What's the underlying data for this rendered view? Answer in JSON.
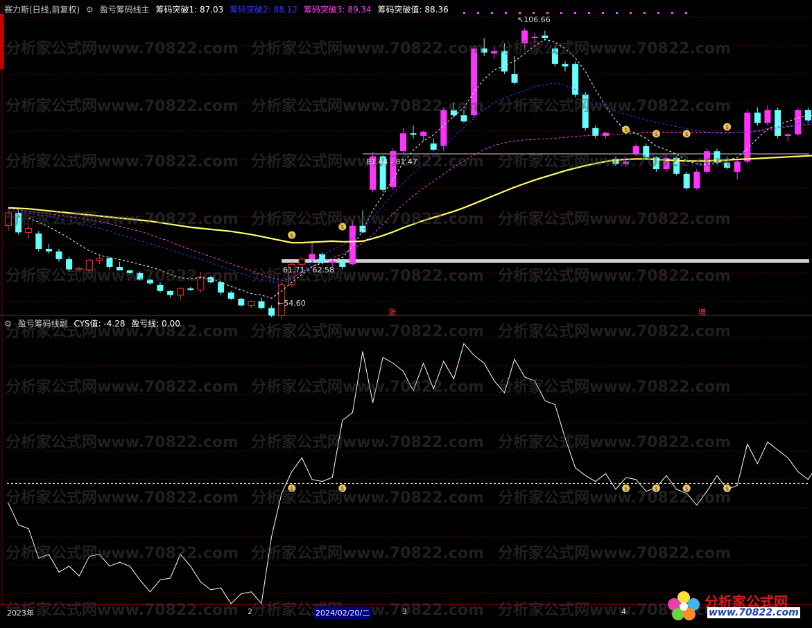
{
  "main_panel": {
    "stock": "赛力斯(日线,前复权)",
    "indicator": "盈亏筹码线主",
    "values": [
      {
        "label": "筹码突破1: 87.03",
        "color": "#ffffff"
      },
      {
        "label": "筹码突破2: 88.12",
        "color": "#2a3cff"
      },
      {
        "label": "筹码突破3: 89.34",
        "color": "#ff44ff"
      },
      {
        "label": "筹码突破值: 88.36",
        "color": "#ffffff"
      }
    ],
    "annotations": {
      "high": "106.66",
      "range_upper": "81.44 - 81.47",
      "range_lower": "61.71 - 62.58",
      "low": "54.60",
      "mark_zhang": "涨",
      "mark_zeng": "增"
    }
  },
  "sub_panel": {
    "indicator": "盈亏筹码线副",
    "values": [
      {
        "label": "CYS值: -4.28",
        "color": "#ffffff"
      },
      {
        "label": "盈亏线: 0.00",
        "color": "#ffffff"
      }
    ]
  },
  "x_axis": {
    "labels": [
      "2023年",
      "2",
      "2024/02/20/二",
      "3",
      "4"
    ]
  },
  "watermark": "分析家公式网www.70822.com",
  "logo": {
    "title": "分析家公式网",
    "url": "www.70822.com"
  },
  "chart_data": [
    {
      "type": "candlestick",
      "title": "盈亏筹码线主",
      "up_color": "#ff33ff",
      "down_color": "#66ffff",
      "ylim": [
        52,
        110
      ],
      "candles": [
        [
          68.5,
          71.5,
          67.5,
          71.0
        ],
        [
          71.0,
          71.5,
          66.8,
          67.2
        ],
        [
          67.2,
          68.5,
          66.0,
          68.0
        ],
        [
          67.0,
          67.5,
          63.5,
          64.0
        ],
        [
          64.0,
          65.0,
          63.0,
          63.5
        ],
        [
          63.5,
          64.0,
          61.5,
          62.0
        ],
        [
          62.0,
          62.5,
          59.5,
          60.0
        ],
        [
          60.0,
          60.5,
          59.8,
          60.2
        ],
        [
          59.8,
          62.0,
          59.5,
          61.8
        ],
        [
          61.8,
          62.5,
          61.0,
          62.2
        ],
        [
          62.2,
          62.5,
          60.0,
          60.5
        ],
        [
          60.5,
          61.5,
          60.0,
          59.8
        ],
        [
          59.8,
          60.0,
          59.0,
          59.3
        ],
        [
          59.3,
          59.6,
          57.8,
          58.0
        ],
        [
          58.0,
          58.2,
          57.0,
          57.3
        ],
        [
          57.0,
          57.5,
          55.5,
          55.8
        ],
        [
          55.8,
          56.0,
          54.5,
          55.0
        ],
        [
          55.0,
          56.5,
          54.0,
          56.3
        ],
        [
          56.3,
          56.6,
          55.8,
          56.0
        ],
        [
          56.0,
          59.5,
          55.5,
          58.5
        ],
        [
          58.5,
          58.8,
          57.3,
          57.5
        ],
        [
          57.5,
          57.8,
          55.0,
          55.5
        ],
        [
          55.5,
          55.8,
          54.0,
          54.3
        ],
        [
          54.3,
          54.5,
          52.8,
          53.0
        ],
        [
          53.0,
          54.0,
          52.5,
          53.8
        ],
        [
          53.8,
          54.5,
          52.2,
          52.5
        ],
        [
          52.5,
          53.0,
          50.7,
          51.0
        ],
        [
          51.0,
          57.5,
          50.4,
          57.0
        ],
        [
          57.0,
          61.5,
          56.5,
          61.0
        ],
        [
          61.0,
          62.5,
          60.0,
          62.0
        ],
        [
          62.0,
          65.5,
          61.5,
          63.0
        ],
        [
          63.0,
          63.3,
          61.0,
          61.3
        ],
        [
          61.3,
          62.0,
          60.5,
          61.7
        ],
        [
          61.7,
          62.0,
          60.0,
          60.5
        ],
        [
          61.0,
          69.5,
          60.8,
          68.5
        ],
        [
          68.5,
          71.5,
          67.0,
          67.2
        ],
        [
          75.5,
          82.8,
          75.0,
          82.0
        ],
        [
          82.0,
          82.2,
          75.0,
          75.5
        ],
        [
          76.0,
          83.5,
          75.5,
          83.0
        ],
        [
          83.0,
          87.5,
          82.5,
          86.5
        ],
        [
          86.5,
          88.0,
          85.5,
          86.2
        ],
        [
          86.0,
          87.0,
          85.0,
          86.8
        ],
        [
          84.5,
          85.5,
          83.0,
          83.3
        ],
        [
          84.0,
          91.5,
          83.0,
          91.0
        ],
        [
          91.0,
          92.5,
          89.5,
          90.0
        ],
        [
          90.0,
          91.0,
          88.5,
          88.8
        ],
        [
          90.0,
          103.5,
          89.5,
          103.0
        ],
        [
          103.0,
          105.0,
          101.5,
          102.2
        ],
        [
          102.0,
          103.5,
          101.0,
          102.5
        ],
        [
          102.5,
          104.0,
          98.0,
          98.5
        ],
        [
          98.0,
          101.5,
          96.0,
          96.3
        ],
        [
          104.0,
          107.0,
          103.0,
          106.5
        ],
        [
          105.0,
          106.0,
          104.0,
          105.3
        ],
        [
          105.5,
          106.5,
          104.5,
          105.0
        ],
        [
          103.0,
          103.5,
          99.5,
          100.0
        ],
        [
          100.0,
          100.5,
          98.5,
          99.5
        ],
        [
          100.0,
          100.5,
          93.5,
          94.0
        ],
        [
          94.0,
          94.5,
          87.0,
          87.5
        ],
        [
          87.5,
          88.0,
          85.5,
          86.0
        ],
        [
          86.0,
          86.8,
          85.5,
          86.6
        ],
        [
          81.5,
          82.0,
          80.2,
          80.5
        ],
        [
          80.5,
          82.0,
          80.0,
          81.0
        ],
        [
          82.5,
          84.5,
          82.0,
          84.0
        ],
        [
          84.0,
          84.5,
          81.5,
          81.8
        ],
        [
          81.8,
          82.0,
          79.0,
          79.5
        ],
        [
          79.5,
          82.5,
          79.0,
          81.7
        ],
        [
          81.7,
          82.0,
          78.3,
          78.6
        ],
        [
          78.6,
          79.0,
          75.5,
          75.8
        ],
        [
          75.8,
          79.5,
          75.5,
          79.0
        ],
        [
          79.0,
          83.5,
          78.5,
          83.0
        ],
        [
          83.0,
          83.5,
          80.5,
          80.8
        ],
        [
          80.8,
          82.0,
          79.5,
          79.8
        ],
        [
          79.0,
          81.5,
          77.5,
          81.0
        ],
        [
          81.0,
          91.0,
          80.5,
          90.5
        ],
        [
          90.5,
          91.5,
          88.0,
          88.5
        ],
        [
          88.5,
          92.0,
          88.0,
          91.0
        ],
        [
          91.0,
          91.5,
          85.5,
          86.0
        ],
        [
          86.0,
          86.5,
          85.0,
          86.3
        ],
        [
          86.3,
          91.5,
          86.0,
          91.0
        ],
        [
          91.0,
          91.5,
          88.5,
          89.0
        ],
        [
          86.0,
          86.5,
          84.5,
          85.0
        ],
        [
          85.0,
          85.5,
          84.5,
          85.2
        ],
        [
          85.2,
          90.0,
          84.5,
          86.0
        ],
        [
          86.0,
          92.0,
          85.5,
          91.5
        ]
      ],
      "series": [
        {
          "values": [
            71.8,
            71.6,
            71.3,
            71.0,
            70.8,
            70.6,
            70.3,
            70.0,
            69.7,
            69.3,
            68.9,
            68.4,
            67.9,
            67.4,
            66.8,
            66.1,
            65.4,
            64.6,
            63.9,
            63.2,
            62.5,
            61.8,
            61.1,
            60.4,
            59.7,
            59.0,
            58.3,
            57.9,
            58.3,
            59.4,
            60.6,
            61.5,
            62.2,
            63.0,
            64.0,
            65.1,
            66.8,
            68.8,
            70.8,
            72.6,
            74.3,
            75.8,
            77.2,
            78.6,
            79.9,
            81.1,
            82.3,
            83.3,
            84.1,
            84.7,
            85.0,
            85.2,
            85.3,
            85.4,
            85.5,
            85.7,
            85.9,
            86.0,
            86.1,
            86.2,
            86.3,
            86.4,
            86.5,
            86.6,
            86.6,
            86.6,
            86.6,
            86.6,
            86.6,
            86.6,
            86.6,
            86.6,
            86.6,
            86.7,
            86.9,
            87.2,
            87.5,
            87.8,
            88.0,
            88.2,
            88.4,
            88.6,
            88.8,
            89.0
          ],
          "color": "#ff44ff",
          "dash": true
        },
        {
          "values": [
            71.4,
            71.2,
            70.9,
            70.6,
            70.3,
            69.9,
            69.5,
            69.0,
            68.5,
            68.0,
            67.4,
            66.8,
            66.2,
            65.6,
            65.0,
            64.4,
            63.8,
            63.2,
            62.6,
            62.0,
            61.3,
            60.6,
            59.9,
            59.2,
            58.6,
            58.0,
            57.5,
            57.3,
            58.1,
            59.7,
            61.4,
            62.8,
            63.8,
            64.7,
            66.0,
            67.5,
            69.9,
            72.4,
            74.7,
            76.8,
            78.7,
            80.5,
            82.2,
            84.0,
            85.8,
            87.6,
            89.4,
            91.1,
            92.5,
            93.4,
            94.1,
            94.8,
            95.6,
            96.0,
            96.3,
            95.8,
            95.0,
            93.8,
            92.6,
            91.6,
            90.8,
            90.2,
            89.6,
            89.1,
            88.6,
            88.2,
            87.8,
            87.4,
            87.0,
            86.7,
            86.5,
            86.5,
            86.6,
            86.8,
            87.1,
            87.4,
            87.7,
            88.0,
            88.3,
            88.6,
            88.8,
            89.0,
            89.2,
            89.3
          ],
          "color": "#2a3cff",
          "dash": true
        },
        {
          "values": [
            null,
            null,
            70.0,
            69.2,
            68.3,
            67.2,
            66.1,
            64.8,
            63.6,
            62.8,
            62.3,
            61.9,
            61.5,
            61.0,
            60.5,
            59.9,
            59.0,
            58.4,
            58.2,
            58.4,
            58.2,
            57.5,
            56.7,
            56.0,
            55.3,
            55.0,
            54.4,
            55.8,
            57.5,
            59.0,
            60.5,
            61.3,
            61.8,
            62.3,
            64.5,
            67.5,
            71.5,
            74.5,
            77.5,
            80.8,
            83.2,
            85.0,
            86.2,
            88.0,
            89.8,
            91.5,
            94.5,
            97.0,
            98.8,
            99.6,
            100.5,
            102.0,
            103.5,
            104.8,
            104.2,
            103.0,
            101.2,
            98.5,
            95.0,
            91.8,
            89.0,
            87.0,
            86.5,
            85.5,
            84.0,
            83.3,
            82.4,
            81.2,
            80.5,
            80.4,
            80.7,
            81.2,
            81.8,
            83.5,
            85.5,
            87.3,
            88.2,
            88.8,
            89.5,
            89.9,
            90.0,
            89.8,
            89.4,
            89.0
          ],
          "color": "#ffffff",
          "dash": true
        },
        {
          "values": [
            72.0,
            71.9,
            71.8,
            71.6,
            71.4,
            71.2,
            71.0,
            70.8,
            70.6,
            70.4,
            70.2,
            70.0,
            69.8,
            69.6,
            69.4,
            69.1,
            68.8,
            68.5,
            68.2,
            68.0,
            67.8,
            67.6,
            67.4,
            67.1,
            66.8,
            66.4,
            66.0,
            65.6,
            65.2,
            65.2,
            65.3,
            65.4,
            65.5,
            65.4,
            65.4,
            65.5,
            66.0,
            66.6,
            67.3,
            68.1,
            68.8,
            69.5,
            70.1,
            70.7,
            71.3,
            72.0,
            72.8,
            73.6,
            74.4,
            75.2,
            76.0,
            76.7,
            77.4,
            78.0,
            78.6,
            79.2,
            79.7,
            80.2,
            80.6,
            81.0,
            81.3,
            81.4,
            81.5,
            81.5,
            81.4,
            81.3,
            81.2,
            81.1,
            81.1,
            81.1,
            81.2,
            81.3,
            81.4,
            81.5,
            81.6,
            81.7,
            81.8,
            81.9,
            82.0,
            82.1,
            82.2,
            82.3,
            82.4,
            82.5
          ],
          "color": "#ffff66",
          "width": 2.2
        }
      ]
    },
    {
      "type": "line",
      "title": "盈亏筹码线副",
      "ylim": [
        -6,
        8
      ],
      "series": [
        {
          "name": "CYS值",
          "color": "#ffffff",
          "values": [
            -1.0,
            -2.1,
            -2.3,
            -3.8,
            -3.6,
            -4.5,
            -4.2,
            -4.7,
            -3.7,
            -3.6,
            -4.2,
            -4.0,
            -4.2,
            -4.9,
            -5.5,
            -4.9,
            -4.8,
            -3.6,
            -4.2,
            -5.0,
            -5.4,
            -5.3,
            -6.1,
            -5.6,
            -5.5,
            -6.1,
            -2.7,
            -0.5,
            0.6,
            1.3,
            0.2,
            0.1,
            0.3,
            3.2,
            3.6,
            6.7,
            4.1,
            6.4,
            6.1,
            5.7,
            4.7,
            6.1,
            4.8,
            6.2,
            5.3,
            7.1,
            6.5,
            6.1,
            5.2,
            4.6,
            6.3,
            5.4,
            5.2,
            4.2,
            4.0,
            2.3,
            0.8,
            0.4,
            0.1,
            0.5,
            -0.3,
            0.3,
            0.2,
            -0.4,
            -0.2,
            0.4,
            -0.3,
            -0.5,
            -1.1,
            -0.4,
            0.4,
            -0.3,
            -0.1,
            2.0,
            1.0,
            2.1,
            1.7,
            1.3,
            0.6,
            0.2,
            1.0,
            1.2,
            1.3
          ]
        },
        {
          "name": "盈亏线",
          "color": "#ffffcc",
          "dash": true,
          "values": [
            0.0
          ]
        }
      ]
    }
  ]
}
